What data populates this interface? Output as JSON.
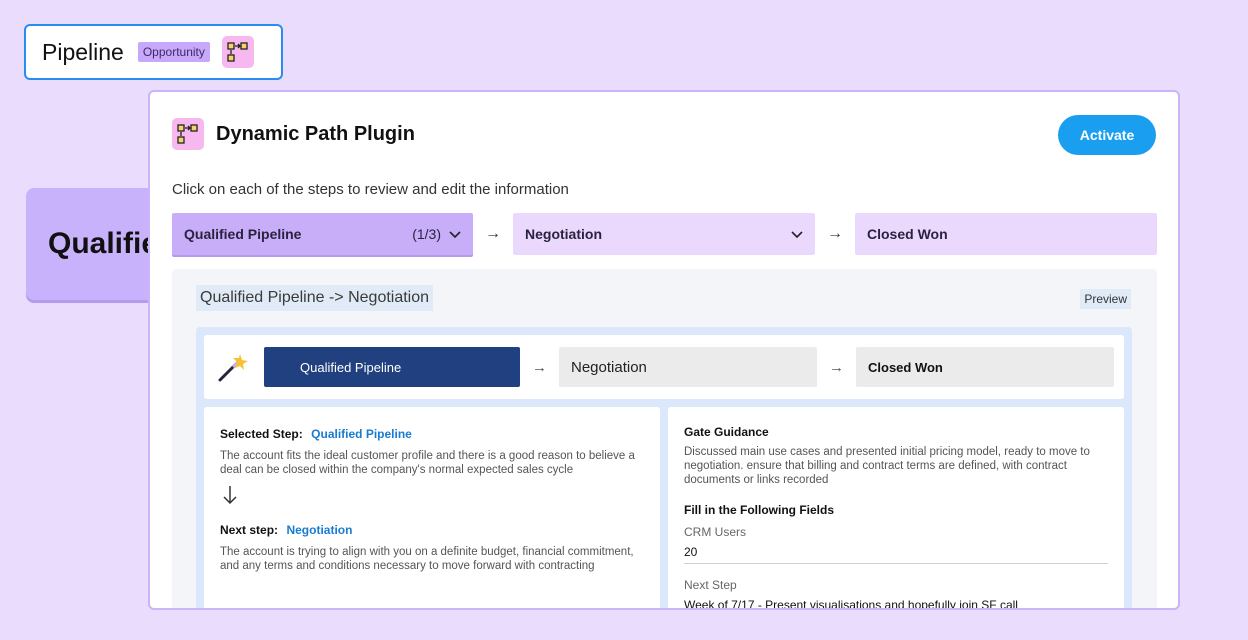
{
  "pipeline_chip": {
    "title": "Pipeline",
    "badge": "Opportunity"
  },
  "background_label": "Qualified",
  "plugin": {
    "title": "Dynamic Path Plugin",
    "activate_label": "Activate",
    "instructions": "Click on each of the steps to review and edit the information"
  },
  "steps": [
    {
      "label": "Qualified Pipeline",
      "count": "(1/3)"
    },
    {
      "label": "Negotiation"
    },
    {
      "label": "Closed Won"
    }
  ],
  "preview": {
    "transition_title": "Qualified Pipeline -> Negotiation",
    "tag": "Preview",
    "path": [
      "Qualified Pipeline",
      "Negotiation",
      "Closed Won"
    ],
    "selected_step_label": "Selected Step:",
    "selected_step_value": "Qualified Pipeline",
    "selected_step_desc": "The account fits the ideal customer profile and there is a good reason to believe a deal can be closed within the company's normal expected sales cycle",
    "next_step_label": "Next step:",
    "next_step_value": "Negotiation",
    "next_step_desc": "The account is trying to align with you on a definite budget, financial commitment, and any terms and conditions necessary to move forward with contracting",
    "gate_title": "Gate Guidance",
    "gate_desc": "Discussed main use cases and presented initial pricing model, ready to move to negotiation. ensure that billing and contract terms are defined, with contract documents or links recorded",
    "fields_title": "Fill in the Following Fields",
    "fields": [
      {
        "label": "CRM Users",
        "value": "20"
      },
      {
        "label": "Next Step",
        "value": "Week of 7/17 - Present visualisations and hopefully join SF call"
      }
    ]
  },
  "colors": {
    "accent": "#1a9ff0",
    "active_step": "#c8adf9",
    "path_done": "#21407f",
    "link": "#1a7bd1"
  }
}
